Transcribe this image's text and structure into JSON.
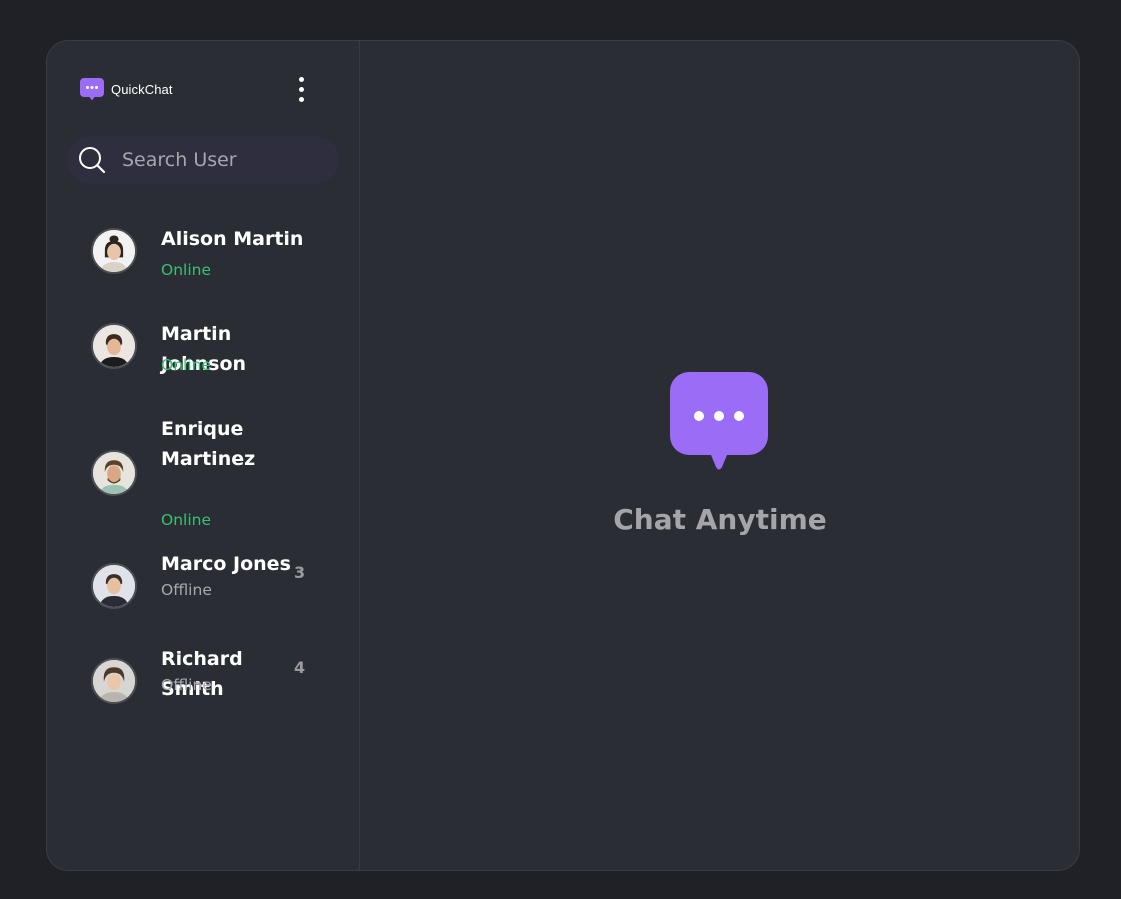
{
  "app": {
    "name": "QuickChat",
    "accent_color": "#9b6cf5"
  },
  "header": {
    "menu_icon": "more-vertical-icon"
  },
  "search": {
    "placeholder": "Search User",
    "value": "",
    "icon": "search-icon"
  },
  "contacts": [
    {
      "name": "Alison Martin",
      "status": "Online",
      "unread": ""
    },
    {
      "name": "Martin Johnson",
      "status": "Online",
      "unread": ""
    },
    {
      "name": "Enrique Martinez",
      "status": "Online",
      "unread": ""
    },
    {
      "name": "Marco Jones",
      "status": "Offline",
      "unread": "3"
    },
    {
      "name": "Richard Smith",
      "status": "Offline",
      "unread": "4"
    }
  ],
  "main": {
    "empty_title": "Chat Anytime",
    "empty_icon": "chat-bubble-icon"
  },
  "colors": {
    "online": "#38c172",
    "offline": "#a8a8ae",
    "background": "#2a2d33",
    "page_background": "#1f2126"
  }
}
